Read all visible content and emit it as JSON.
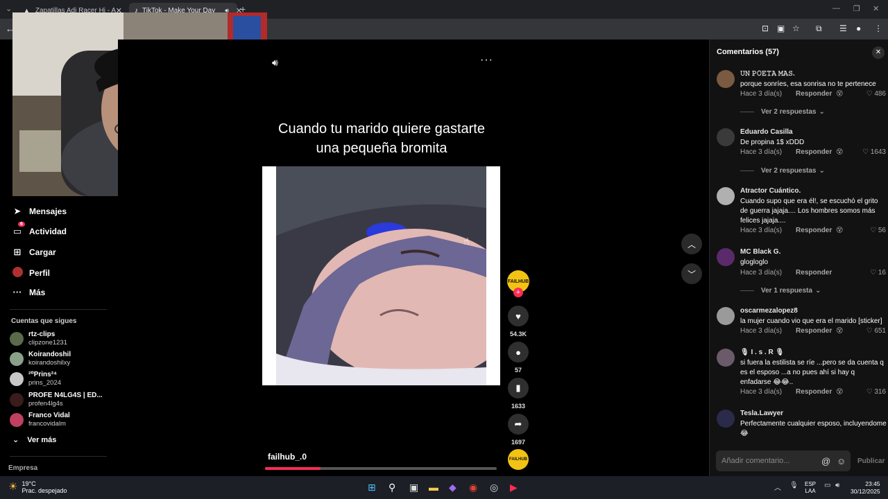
{
  "browser": {
    "tabs": [
      {
        "title": "Zapatillas Adi Racer Hi - Azul a",
        "active": false
      },
      {
        "title": "TikTok - Make Your Day",
        "active": true
      }
    ]
  },
  "sidebar": {
    "items": [
      {
        "label": "Mensajes",
        "icon": "send-icon"
      },
      {
        "label": "Actividad",
        "icon": "inbox-icon",
        "badge": "6"
      },
      {
        "label": "Cargar",
        "icon": "upload-icon"
      },
      {
        "label": "Perfil",
        "icon": "profile-icon"
      },
      {
        "label": "Más",
        "icon": "more-icon"
      }
    ],
    "following_title": "Cuentas que sigues",
    "accounts": [
      {
        "name": "rtz-clips",
        "handle": "clipzone1231"
      },
      {
        "name": "Koirandoshil",
        "handle": "koirandoshilxy"
      },
      {
        "name": "²⁰Prins²⁴",
        "handle": "prins_2024"
      },
      {
        "name": "PROFE N4LG4S | ED...",
        "handle": "profen4lg4s"
      },
      {
        "name": "Franco Vidal",
        "handle": "francovidalm"
      }
    ],
    "see_more": "Ver más",
    "footer": "Empresa"
  },
  "video": {
    "caption_line1": "Cuando tu marido quiere gastarte",
    "caption_line2": "una pequeña bromita",
    "author": "failhub_.0",
    "progress": 0.24,
    "creator_badge": "FAILHUB",
    "likes": "54.3K",
    "comments": "57",
    "saves": "1633",
    "shares": "1697"
  },
  "comments_panel": {
    "title": "Comentarios (57)",
    "input_placeholder": "Añadir comentario...",
    "publish": "Publicar",
    "reply_label": "Responder",
    "comments": [
      {
        "user": "𝚄𝙽 𝙿𝙾𝙴𝚃𝙰 𝙼𝙰𝚂.",
        "text": "porque sonríes, esa sonrisa no te pertenece",
        "time": "Hace 3 día(s)",
        "likes": "486",
        "replies": "Ver 2 respuestas"
      },
      {
        "user": "Eduardo Casilla",
        "text": "De propina 1$ xDDD",
        "time": "Hace 3 día(s)",
        "likes": "1643",
        "replies": "Ver 2 respuestas"
      },
      {
        "user": "Atractor Cuántico.",
        "text": "Cuando supo que era él!, se escuchó el grito de guerra jajaja.... Los hombres somos más felices jajaja....",
        "time": "Hace 3 día(s)",
        "likes": "56",
        "replies": ""
      },
      {
        "user": "MC Black G.",
        "text": "glogloglo",
        "time": "Hace 3 día(s)",
        "likes": "16",
        "replies": "Ver 1 respuesta"
      },
      {
        "user": "oscarmezalopez8",
        "text": "la mujer cuando vio que era el marido [sticker]",
        "time": "Hace 3 día(s)",
        "likes": "651",
        "replies": ""
      },
      {
        "user": "🎙 I . s . R 🎙",
        "text": "si fuera la estilista se ríe ...pero se da cuenta q es el esposo ...a no pues ahí si hay q enfadarse 😂😂..",
        "time": "Hace 3 día(s)",
        "likes": "316",
        "replies": ""
      },
      {
        "user": "Tesla.Lawyer",
        "text": "Perfectamente cualquier esposo, incluyendome 😂",
        "time": "",
        "likes": "",
        "replies": ""
      }
    ]
  },
  "taskbar": {
    "temp": "19°C",
    "weather": "Prac. despejado",
    "lang1": "ESP",
    "lang2": "LAA",
    "time": "23:45",
    "date": "30/12/2025"
  },
  "colors": {
    "accent": "#fe2c55",
    "background": "#121212"
  }
}
